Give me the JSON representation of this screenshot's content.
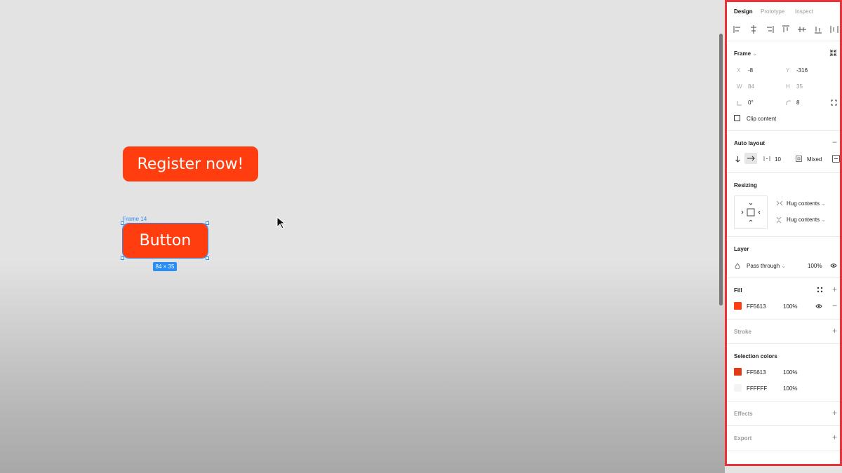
{
  "canvas": {
    "register_button_label": "Register now!",
    "button_label": "Button",
    "frame_label": "Frame 14",
    "size_badge": "84 × 35"
  },
  "panel": {
    "tabs": [
      {
        "label": "Design",
        "active": true
      },
      {
        "label": "Prototype",
        "active": false
      },
      {
        "label": "Inspect",
        "active": false
      }
    ],
    "frame": {
      "title": "Frame",
      "chevron": "⌄",
      "x_label": "X",
      "x_value": "-8",
      "y_label": "Y",
      "y_value": "-316",
      "w_label": "W",
      "w_value": "84",
      "h_label": "H",
      "h_value": "35",
      "rotation_value": "0°",
      "radius_value": "8",
      "clip_content_label": "Clip content"
    },
    "auto_layout": {
      "title": "Auto layout",
      "spacing_value": "10",
      "padding_value": "Mixed"
    },
    "resizing": {
      "title": "Resizing",
      "horizontal": "Hug contents",
      "vertical": "Hug contents"
    },
    "layer": {
      "title": "Layer",
      "blend_mode": "Pass through",
      "opacity": "100%"
    },
    "fill": {
      "title": "Fill",
      "hex": "FF5613",
      "opacity": "100%",
      "color": "#ff3d0f"
    },
    "stroke": {
      "title": "Stroke"
    },
    "selection_colors": {
      "title": "Selection colors",
      "items": [
        {
          "hex": "FF5613",
          "opacity": "100%",
          "color": "#e23a14"
        },
        {
          "hex": "FFFFFF",
          "opacity": "100%",
          "color": "#f4f4f4"
        }
      ]
    },
    "effects": {
      "title": "Effects"
    },
    "export": {
      "title": "Export"
    }
  }
}
